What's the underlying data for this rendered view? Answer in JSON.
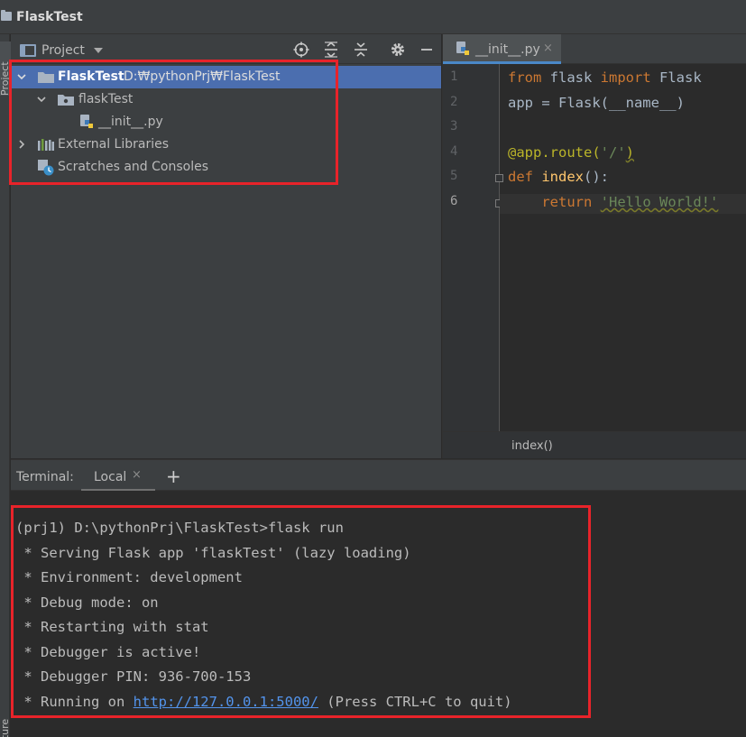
{
  "window": {
    "title": "FlaskTest"
  },
  "sidebar_strip": {
    "top_label": "Project",
    "bottom_label": "Structure"
  },
  "project_panel": {
    "view_label": "Project",
    "tree": [
      {
        "label": "FlaskTest",
        "path": "D:₩pythonPrj₩FlaskTest"
      },
      {
        "label": "flaskTest"
      },
      {
        "label": "__init__.py"
      },
      {
        "label": "External Libraries"
      },
      {
        "label": "Scratches and Consoles"
      }
    ]
  },
  "editor": {
    "tab_label": "__init__.py",
    "tab_close": "×",
    "line_numbers": [
      "1",
      "2",
      "3",
      "4",
      "5",
      "6"
    ],
    "code": {
      "l1_from": "from",
      "l1_mod": " flask ",
      "l1_import": "import",
      "l1_name": " Flask",
      "l2": "app = Flask(__name__)",
      "l4_deco": "@app.route(",
      "l4_str": "'/'",
      "l4_close": ")",
      "l5_def": "def",
      "l5_space": " ",
      "l5_fn": "index",
      "l5_rest": "():",
      "l6_indent": "    ",
      "l6_return": "return",
      "l6_space": " ",
      "l6_str": "'Hello World!'"
    },
    "breadcrumb": "index()"
  },
  "terminal": {
    "title": "Terminal:",
    "tab_label": "Local",
    "tab_close": "×",
    "add_label": "+",
    "lines": [
      "(prj1) D:\\pythonPrj\\FlaskTest>flask run",
      " * Serving Flask app 'flaskTest' (lazy loading)",
      " * Environment: development",
      " * Debug mode: on",
      " * Restarting with stat",
      " * Debugger is active!",
      " * Debugger PIN: 936-700-153"
    ],
    "last_line": {
      "prefix": " * Running on ",
      "link": "http://127.0.0.1:5000/",
      "suffix": " (Press CTRL+C to quit)"
    }
  },
  "colors": {
    "highlight_border": "#e8232a",
    "selection": "#4b6eaf",
    "link": "#5394ec",
    "keyword": "#cc7832",
    "string": "#6a8759",
    "decorator": "#bbb529",
    "function": "#ffc66d"
  },
  "icons": [
    "folder-icon",
    "crosshair-icon",
    "expand-all-icon",
    "collapse-all-icon",
    "gear-icon",
    "minimize-icon",
    "python-file-icon",
    "libraries-icon",
    "scratches-icon",
    "close-icon",
    "plus-icon"
  ]
}
